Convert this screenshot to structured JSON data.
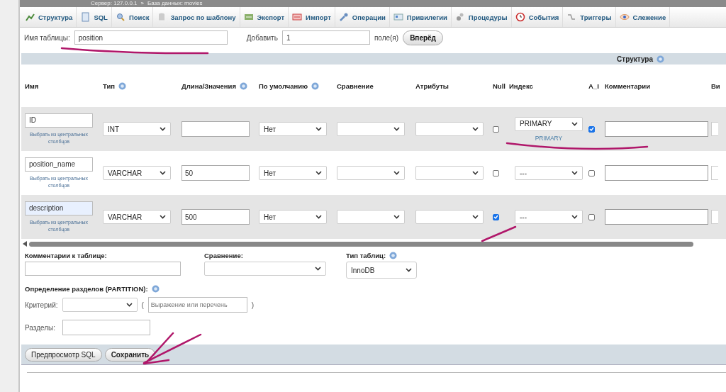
{
  "breadcrumb": {
    "server": "Сервер: 127.0.0.1",
    "separator": "»",
    "database": "База данных: movies"
  },
  "tabs": [
    {
      "label": "Структура",
      "selected": false
    },
    {
      "label": "SQL",
      "selected": false
    },
    {
      "label": "Поиск",
      "selected": false
    },
    {
      "label": "Запрос по шаблону",
      "selected": false
    },
    {
      "label": "Экспорт",
      "selected": false
    },
    {
      "label": "Импорт",
      "selected": false
    },
    {
      "label": "Операции",
      "selected": false
    },
    {
      "label": "Привилегии",
      "selected": false
    },
    {
      "label": "Процедуры",
      "selected": false
    },
    {
      "label": "События",
      "selected": false
    },
    {
      "label": "Триггеры",
      "selected": false
    },
    {
      "label": "Слежение",
      "selected": false
    }
  ],
  "table_form": {
    "name_label": "Имя таблицы:",
    "name_value": "position",
    "add_label": "Добавить",
    "add_value": "1",
    "fields_label": "поле(я)",
    "go_button": "Вперёд"
  },
  "structure_header": "Структура",
  "columns": [
    {
      "label": "Имя"
    },
    {
      "label": "Тип",
      "help": true
    },
    {
      "label": "Длина/Значения",
      "help": true
    },
    {
      "label": "По умолчанию",
      "help": true
    },
    {
      "label": "Сравнение"
    },
    {
      "label": "Атрибуты"
    },
    {
      "label": "Null"
    },
    {
      "label": "Индекс"
    },
    {
      "label": "A_I"
    },
    {
      "label": "Комментарии"
    },
    {
      "label": "Ви"
    }
  ],
  "rows": [
    {
      "name": "ID",
      "focused": false,
      "central_link": "Выбрать из центральных столбцов",
      "type": "INT",
      "length": "",
      "default": "Нет",
      "collation": "",
      "attributes": "",
      "null": false,
      "index": "PRIMARY",
      "index_note": "PRIMARY",
      "ai": true
    },
    {
      "name": "position_name",
      "focused": false,
      "central_link": "Выбрать из центральных столбцов",
      "type": "VARCHAR",
      "length": "50",
      "default": "Нет",
      "collation": "",
      "attributes": "",
      "null": false,
      "index": "---",
      "ai": false
    },
    {
      "name": "description",
      "focused": true,
      "central_link": "Выбрать из центральных столбцов",
      "type": "VARCHAR",
      "length": "500",
      "default": "Нет",
      "collation": "",
      "attributes": "",
      "null": true,
      "index": "---",
      "ai": false
    }
  ],
  "table_comment_label": "Комментарии к таблице:",
  "collation_label": "Сравнение:",
  "engine_label": "Тип таблиц:",
  "engine_value": "InnoDB",
  "partition_label": "Определение разделов (PARTITION):",
  "criterion_label": "Критерий:",
  "open_paren": "(",
  "expression_placeholder": "Выражение или перечень",
  "close_paren": ")",
  "partitions_label": "Разделы:",
  "buttons": [
    "Предпросмотр SQL",
    "Сохранить"
  ]
}
